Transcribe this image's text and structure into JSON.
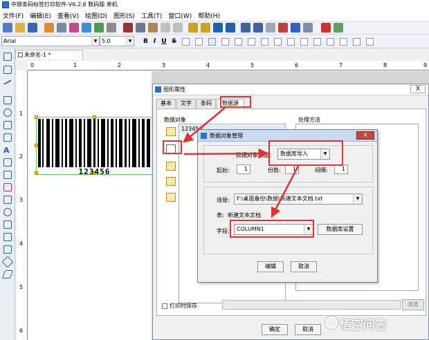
{
  "window": {
    "title": "中琅条码标签打印软件-V6.2.6 数码版 单机"
  },
  "menu": [
    "文件(F)",
    "编辑(E)",
    "查看(V)",
    "绘图(D)",
    "图形(S)",
    "工具(T)",
    "窗口(W)",
    "帮助(H)"
  ],
  "format_bar": {
    "font_name": "Arial",
    "font_size": "5.0",
    "bold": "B",
    "italic": "I",
    "underline": "U",
    "strike": "S"
  },
  "document": {
    "tab_label": "未命名-1 *"
  },
  "ruler": {
    "h_labels": [
      "0",
      "1",
      "2",
      "3",
      "4",
      "5",
      "6",
      "7",
      "8",
      "9"
    ],
    "v_labels": [
      "1",
      "2",
      "3",
      "4",
      "5",
      "6"
    ]
  },
  "barcode": {
    "text": "123456"
  },
  "dialog_graphic": {
    "title": "图形属性",
    "close": "X",
    "tabs": [
      "基本",
      "文字",
      "条码",
      "数据源"
    ],
    "data_objects_label": "数据对象",
    "object_item": "123456",
    "process_label": "处理方法",
    "print_save_label": "打印时保存",
    "browse_label": "浏览",
    "ok_label": "确定",
    "cancel_label": "取消"
  },
  "dialog_db": {
    "title": "数据对象管理",
    "close": "X",
    "type_label": "数据对象类型:",
    "type_value": "数据库导入",
    "start_label": "起始:",
    "start_value": "1",
    "count_label": "份数:",
    "count_value": "1",
    "interval_label": "间隔:",
    "interval_value": "1",
    "connect_label": "连接:",
    "connect_value": "F:\\桌面备份\\数据\\新建文本文档.txt",
    "table_label": "表:",
    "table_value": "新建文本文档",
    "field_label": "字段:",
    "field_value": "COLUMN1",
    "db_settings_label": "数据库设置",
    "edit_label": "编辑",
    "cancel_label": "取消"
  },
  "watermark": {
    "text": "悟空问答"
  },
  "colors": {
    "highlight": "#e53030",
    "selection": "#5bd35b",
    "handle": "#ffd400",
    "accent": "#2a6fc9"
  }
}
